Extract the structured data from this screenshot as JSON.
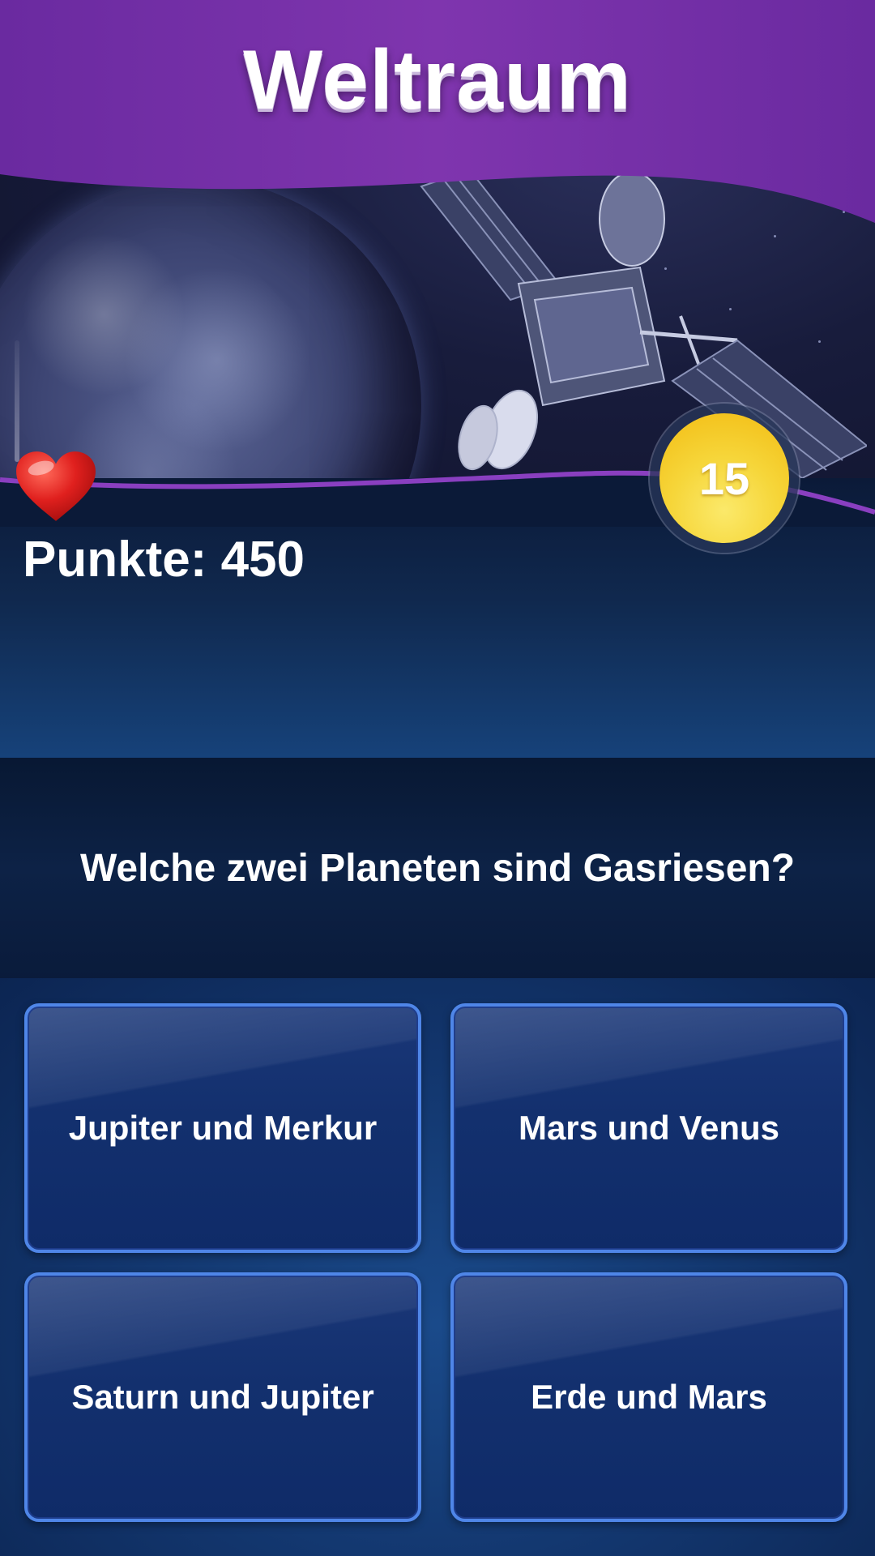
{
  "game": {
    "title": "Weltraum",
    "score_label": "Punkte: 450",
    "timer": "15",
    "lives": 1
  },
  "question": {
    "text": "Welche zwei Planeten sind Gasriesen?"
  },
  "answers": [
    {
      "label": "Jupiter und Merkur"
    },
    {
      "label": "Mars und Venus"
    },
    {
      "label": "Saturn und Jupiter"
    },
    {
      "label": "Erde und Mars"
    }
  ],
  "colors": {
    "header_purple": "#7a36a6",
    "timer_yellow": "#f6d63a",
    "answer_border": "#4f86e8",
    "heart_red": "#e0201e"
  },
  "icons": {
    "life": "heart-icon"
  }
}
